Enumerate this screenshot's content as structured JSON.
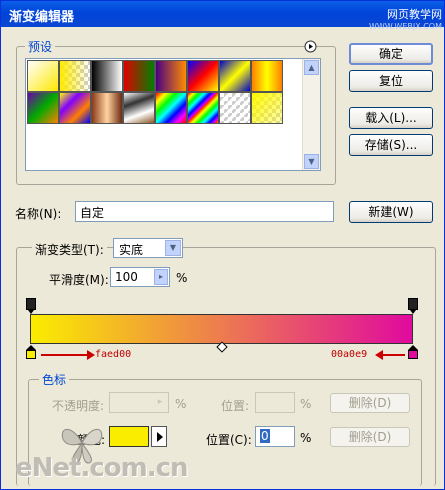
{
  "window": {
    "title": "渐变编辑器",
    "watermark_main": "网页教学网",
    "watermark_sub": "WWW.WEBJX.COM"
  },
  "presets": {
    "label": "预设",
    "menu_icon": "circle-arrow-right-icon",
    "swatches": [
      "fg-to-bg",
      "fg-to-transparent",
      "black-white",
      "red-green",
      "violet-orange",
      "blue-red-yellow",
      "blue-yellow-blue",
      "orange-yellow-orange",
      "violet-green-orange",
      "yellow-violet-orange-blue",
      "copper",
      "chrome",
      "spectrum",
      "transparent-rainbow",
      "transparent-stripes",
      "yellow-transparent"
    ]
  },
  "buttons": {
    "ok": "确定",
    "reset": "复位",
    "load": "载入(L)...",
    "save": "存储(S)...",
    "new": "新建(W)"
  },
  "name": {
    "label": "名称(N):",
    "value": "自定"
  },
  "gradient": {
    "type_label": "渐变类型(T):",
    "type_value": "实底",
    "smoothness_label": "平滑度(M):",
    "smoothness_value": "100",
    "smoothness_unit": "%",
    "start_color": "#faed00",
    "end_color": "#e00a9e",
    "midpoint_position": 0.5
  },
  "annotations": {
    "left": "faed00",
    "right": "00a0e9"
  },
  "stops": {
    "label": "色标",
    "opacity_label": "不透明度:",
    "opacity_unit": "%",
    "opacity_location_label": "位置:",
    "opacity_location_unit": "%",
    "opacity_delete": "删除(D)",
    "color_label": "颜色:",
    "color_value": "#faed00",
    "color_location_label": "位置(C):",
    "color_location_value": "0",
    "color_location_unit": "%",
    "color_delete": "删除(D)"
  },
  "footer_watermark": "eNet.com.cn"
}
